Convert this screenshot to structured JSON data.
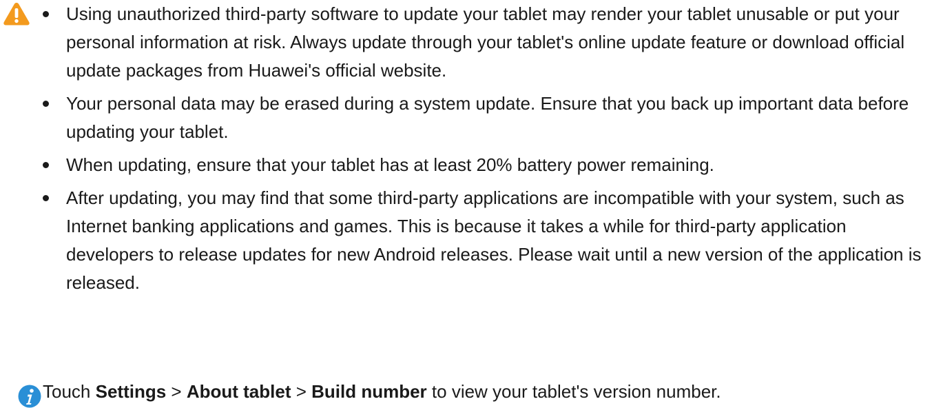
{
  "warning": {
    "icon": "warning-triangle-icon",
    "icon_color": "#f39a1e",
    "items": [
      "Using unauthorized third-party software to update your tablet may render your tablet unusable or put your personal information at risk. Always update through your tablet's online update feature or download official update packages from Huawei's official website.",
      "Your personal data may be erased during a system update. Ensure that you back up important data before updating your tablet.",
      "When updating, ensure that your tablet has at least 20% battery power remaining.",
      "After updating, you may find that some third-party applications are incompatible with your system, such as Internet banking applications and games. This is because it takes a while for third-party application developers to release updates for new Android releases. Please wait until a new version of the application is released."
    ]
  },
  "note": {
    "icon": "info-icon",
    "icon_color": "#2a8fd6",
    "prefix": "Touch ",
    "step1": "Settings",
    "sep1": " > ",
    "step2": "About tablet",
    "sep2": " > ",
    "step3": "Build number",
    "suffix": " to view your tablet's version number."
  }
}
